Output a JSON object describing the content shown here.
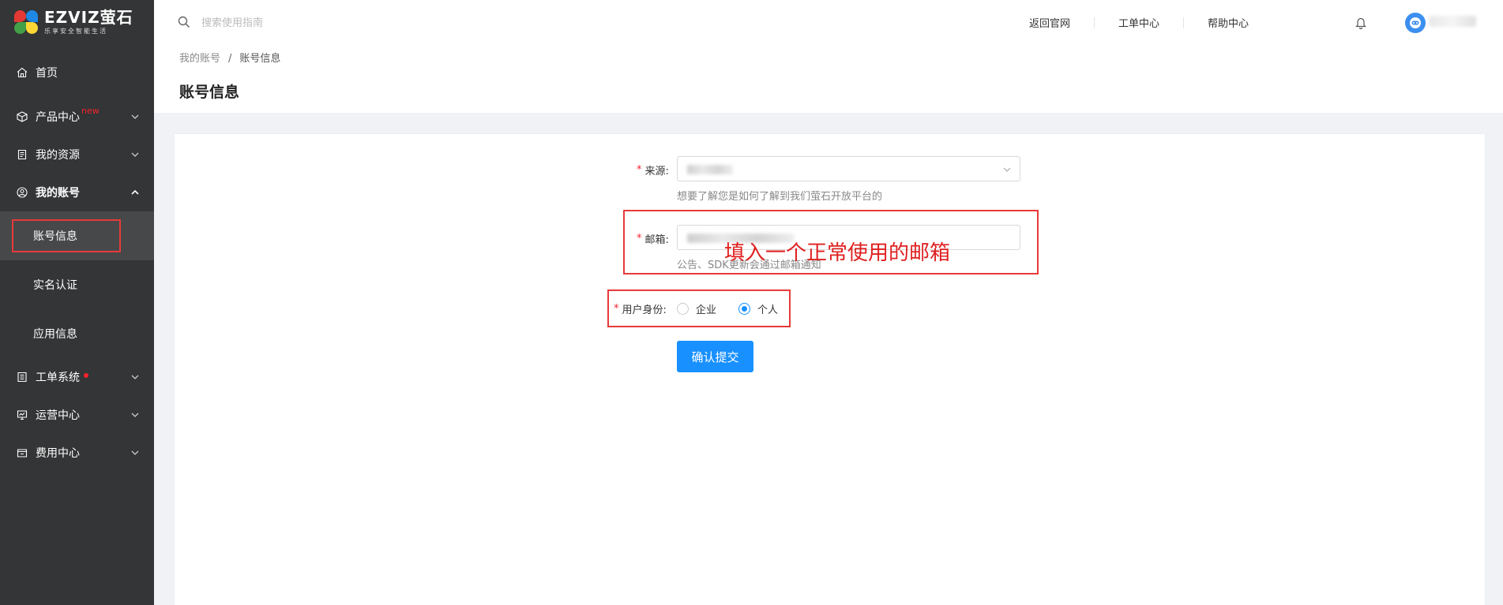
{
  "brand": {
    "name": "EZVIZ萤石",
    "tagline": "乐享安全智能生活"
  },
  "sidebar": {
    "items": [
      {
        "label": "首页",
        "icon": "home-icon"
      },
      {
        "label": "产品中心",
        "icon": "cube-icon",
        "badge": "new"
      },
      {
        "label": "我的资源",
        "icon": "document-icon"
      },
      {
        "label": "我的账号",
        "icon": "user-circle-icon",
        "expanded": true,
        "children": [
          {
            "label": "账号信息",
            "active": true
          },
          {
            "label": "实名认证"
          },
          {
            "label": "应用信息"
          }
        ]
      },
      {
        "label": "工单系统",
        "icon": "list-icon",
        "dot": true
      },
      {
        "label": "运营中心",
        "icon": "monitor-icon"
      },
      {
        "label": "费用中心",
        "icon": "wallet-icon"
      }
    ]
  },
  "header": {
    "search_placeholder": "搜索使用指南",
    "links": [
      "返回官网",
      "工单中心",
      "帮助中心"
    ]
  },
  "breadcrumb": {
    "root": "我的账号",
    "separator": "/",
    "current": "账号信息"
  },
  "page_title": "账号信息",
  "form": {
    "source": {
      "label": "来源:",
      "hint": "想要了解您是如何了解到我们萤石开放平台的"
    },
    "email": {
      "label": "邮箱:",
      "hint": "公告、SDK更新会通过邮箱通知"
    },
    "identity": {
      "label": "用户身份:",
      "options": [
        "企业",
        "个人"
      ],
      "selected": "个人"
    },
    "submit_label": "确认提交"
  },
  "annotation": "填入一个正常使用的邮箱",
  "colors": {
    "sidebar_bg": "#333536",
    "primary": "#1890ff",
    "annotation_red": "#e83a3a"
  }
}
